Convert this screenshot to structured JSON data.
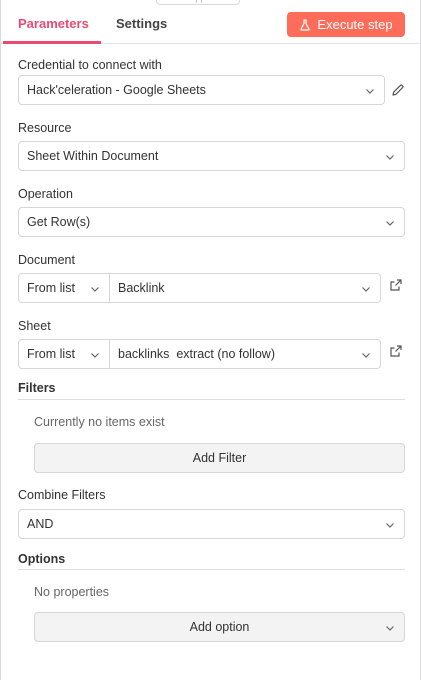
{
  "tabs": {
    "parameters": "Parameters",
    "settings": "Settings"
  },
  "execute_button": "Execute step",
  "credential": {
    "label": "Credential to connect with",
    "value": "Hack'celeration - Google Sheets"
  },
  "resource": {
    "label": "Resource",
    "value": "Sheet Within Document"
  },
  "operation": {
    "label": "Operation",
    "value": "Get Row(s)"
  },
  "document": {
    "label": "Document",
    "mode": "From list",
    "value": "Backlink"
  },
  "sheet": {
    "label": "Sheet",
    "mode": "From list",
    "value": "backlinks  extract (no follow)"
  },
  "filters": {
    "title": "Filters",
    "empty_text": "Currently no items exist",
    "add_button": "Add Filter"
  },
  "combine_filters": {
    "label": "Combine Filters",
    "value": "AND"
  },
  "options": {
    "title": "Options",
    "empty_text": "No properties",
    "add_button": "Add option"
  },
  "colors": {
    "accent": "#ea4b71",
    "execute_bg": "#ff6d5a"
  },
  "icons": {
    "execute": "flask-icon",
    "edit": "pencil-icon",
    "open": "external-link-icon",
    "dropdown": "chevron-down-icon"
  }
}
